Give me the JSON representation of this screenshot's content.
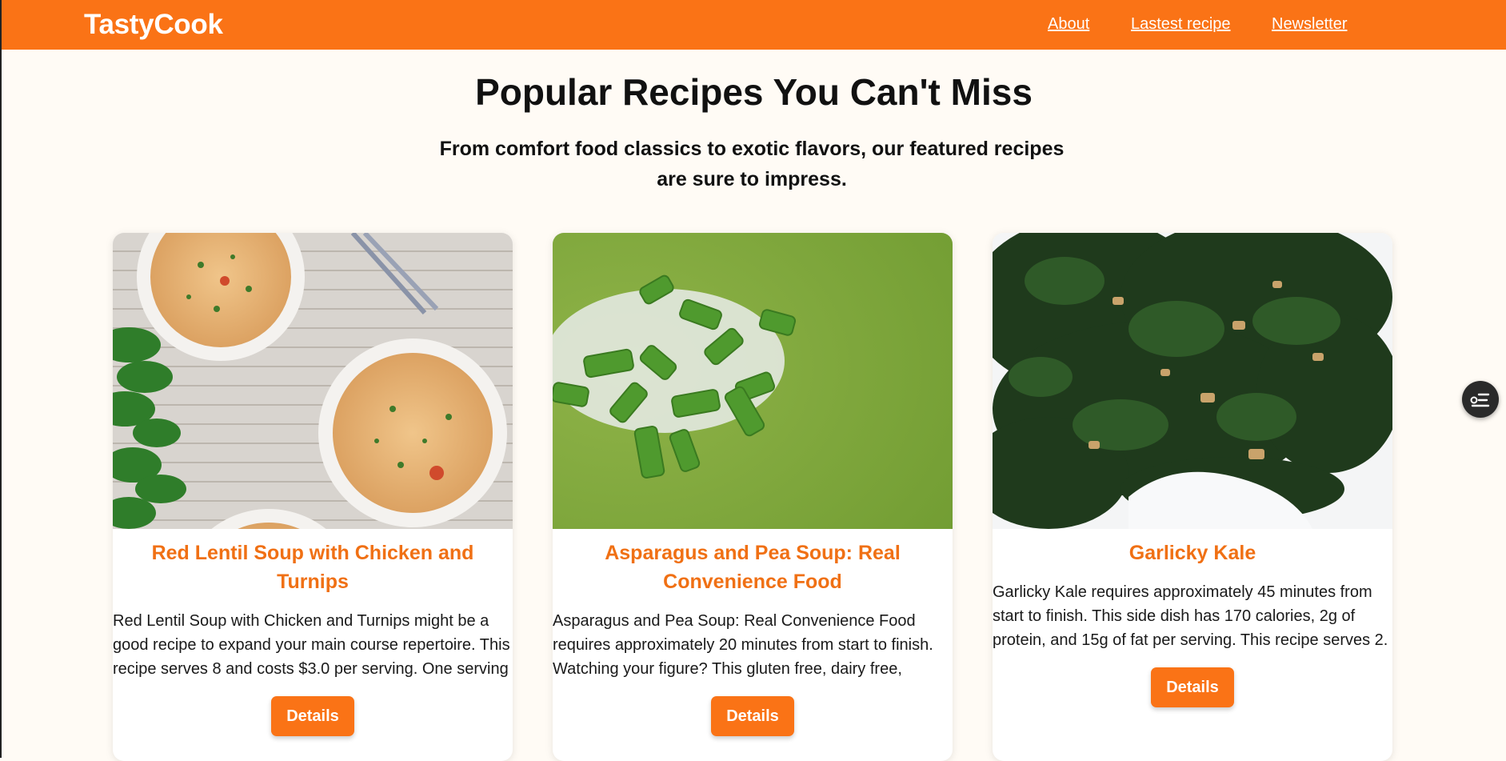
{
  "header": {
    "brand": "TastyCook",
    "nav": [
      "About",
      "Lastest recipe",
      "Newsletter"
    ]
  },
  "hero": {
    "title": "Popular Recipes You Can't Miss",
    "subtitle": "From comfort food classics to exotic flavors, our featured recipes are sure to impress."
  },
  "recipes": [
    {
      "title": "Red Lentil Soup with Chicken and Turnips",
      "description": "Red Lentil Soup with Chicken and Turnips might be a good recipe to expand your main course repertoire. This recipe serves 8 and costs $3.0 per serving. One serving",
      "button": "Details"
    },
    {
      "title": "Asparagus and Pea Soup: Real Convenience Food",
      "description": "Asparagus and Pea Soup: Real Convenience Food requires approximately 20 minutes from start to finish. Watching your figure? This gluten free, dairy free,",
      "button": "Details"
    },
    {
      "title": "Garlicky Kale",
      "description": "Garlicky Kale requires approximately 45 minutes from start to finish. This side dish has 170 calories, 2g of protein, and 15g of fat per serving. This recipe serves 2.",
      "button": "Details"
    }
  ],
  "floating_button_icon": "list-filter-icon",
  "colors": {
    "accent": "#fa7316",
    "title": "#f07014",
    "background": "#fffbf5"
  }
}
